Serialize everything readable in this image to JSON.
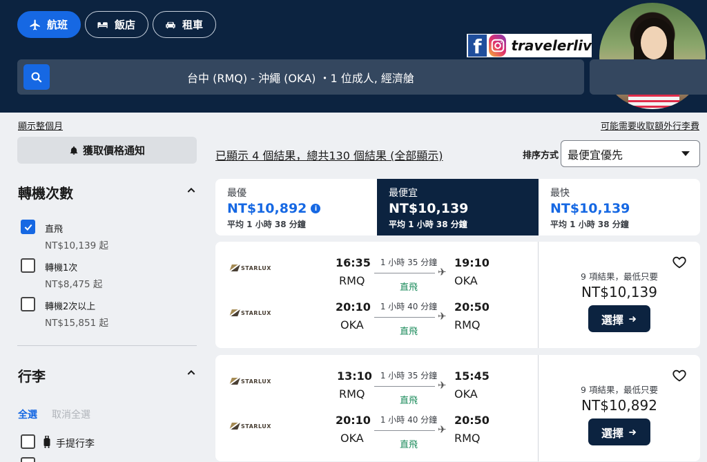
{
  "header": {
    "tabs": [
      {
        "label": "航班",
        "icon": "plane-icon",
        "active": true
      },
      {
        "label": "飯店",
        "icon": "bed-icon",
        "active": false
      },
      {
        "label": "租車",
        "icon": "car-icon",
        "active": false
      }
    ],
    "search_summary": "台中 (RMQ) - 沖繩 (OKA) ・1 位成人, 經濟艙",
    "brand": {
      "name": "travelerliv",
      "icons": [
        "facebook-icon",
        "instagram-icon"
      ]
    }
  },
  "links": {
    "show_month": "顯示整個月",
    "baggage_fee": "可能需要收取額外行李費"
  },
  "filters": {
    "alert_label": "獲取價格通知",
    "stops": {
      "title": "轉機次數",
      "options": [
        {
          "label": "直飛",
          "price": "NT$10,139 起",
          "checked": true
        },
        {
          "label": "轉機1次",
          "price": "NT$8,475 起",
          "checked": false
        },
        {
          "label": "轉機2次以上",
          "price": "NT$15,851 起",
          "checked": false
        }
      ]
    },
    "baggage": {
      "title": "行李",
      "select_all": "全選",
      "deselect_all": "取消全選",
      "options": [
        {
          "label": "手提行李",
          "checked": false
        }
      ]
    }
  },
  "results": {
    "count_text": "已顯示 4 個結果，總共130 個結果 (全部顯示)",
    "sort_label": "排序方式",
    "sort_value": "最便宜優先"
  },
  "sort_tabs": [
    {
      "label": "最優",
      "price": "NT$10,892",
      "sub": "平均 1 小時 38 分鐘",
      "selected": false,
      "info": true
    },
    {
      "label": "最便宜",
      "price": "NT$10,139",
      "sub": "平均 1 小時 38 分鐘",
      "selected": true,
      "info": false
    },
    {
      "label": "最快",
      "price": "NT$10,139",
      "sub": "平均 1 小時 38 分鐘",
      "selected": false,
      "info": false
    }
  ],
  "flights": [
    {
      "airline": "STARLUX",
      "legs": [
        {
          "dep_time": "16:35",
          "dep_code": "RMQ",
          "duration": "1 小時 35 分鐘",
          "stops": "直飛",
          "arr_time": "19:10",
          "arr_code": "OKA"
        },
        {
          "dep_time": "20:10",
          "dep_code": "OKA",
          "duration": "1 小時 40 分鐘",
          "stops": "直飛",
          "arr_time": "20:50",
          "arr_code": "RMQ"
        }
      ],
      "price_note": "9 項結果，最低只要",
      "price": "NT$10,139",
      "select_label": "選擇"
    },
    {
      "airline": "STARLUX",
      "legs": [
        {
          "dep_time": "13:10",
          "dep_code": "RMQ",
          "duration": "1 小時 35 分鐘",
          "stops": "直飛",
          "arr_time": "15:45",
          "arr_code": "OKA"
        },
        {
          "dep_time": "20:10",
          "dep_code": "OKA",
          "duration": "1 小時 40 分鐘",
          "stops": "直飛",
          "arr_time": "20:50",
          "arr_code": "RMQ"
        }
      ],
      "price_note": "9 項結果，最低只要",
      "price": "NT$10,892",
      "select_label": "選擇"
    }
  ],
  "colors": {
    "header_bg": "#0c2340",
    "accent": "#1668e3",
    "nonstop_green": "#1a8a5a"
  }
}
